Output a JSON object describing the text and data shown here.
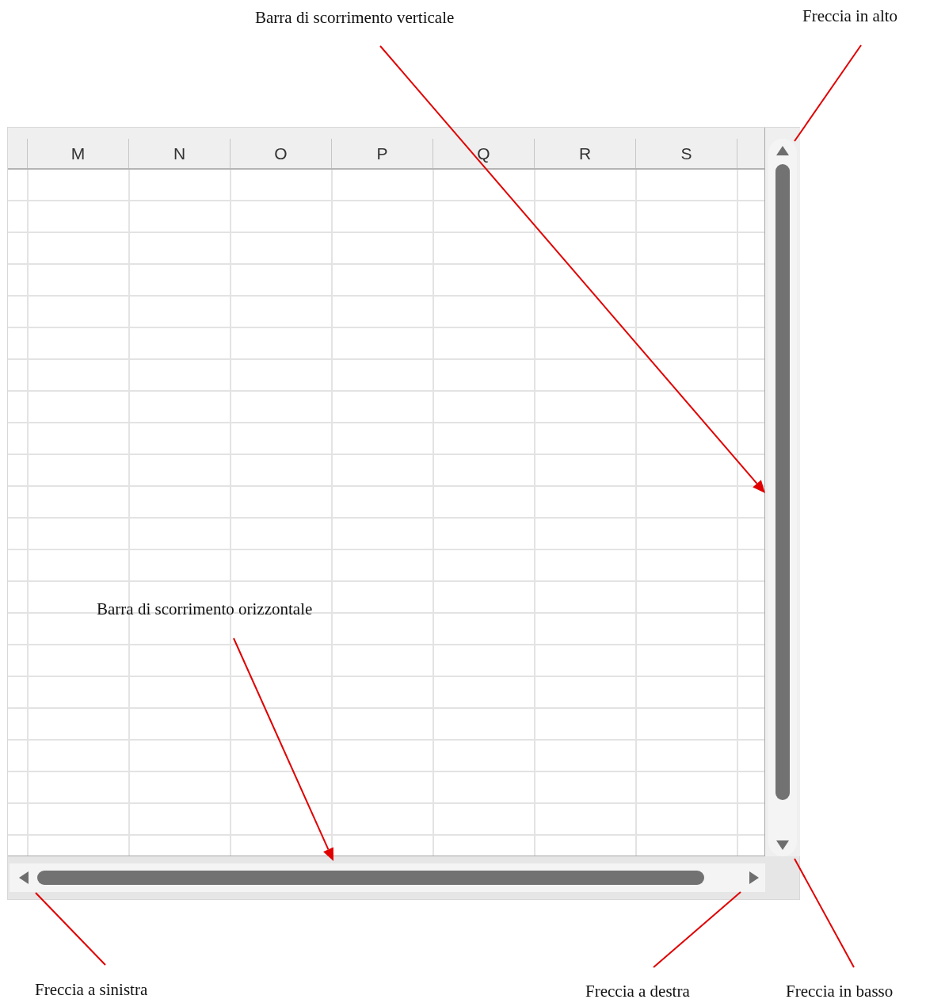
{
  "sheet": {
    "columns": [
      "M",
      "N",
      "O",
      "P",
      "Q",
      "R",
      "S"
    ]
  },
  "annotations": [
    {
      "label": "Barra di scorrimento verticale",
      "arrowhead": true
    },
    {
      "label": "Freccia in alto",
      "arrowhead": false
    },
    {
      "label": "Barra di scorrimento orizzontale",
      "arrowhead": true
    },
    {
      "label": "Freccia a sinistra",
      "arrowhead": false
    },
    {
      "label": "Freccia a destra",
      "arrowhead": false
    },
    {
      "label": "Freccia in basso",
      "arrowhead": false
    }
  ]
}
